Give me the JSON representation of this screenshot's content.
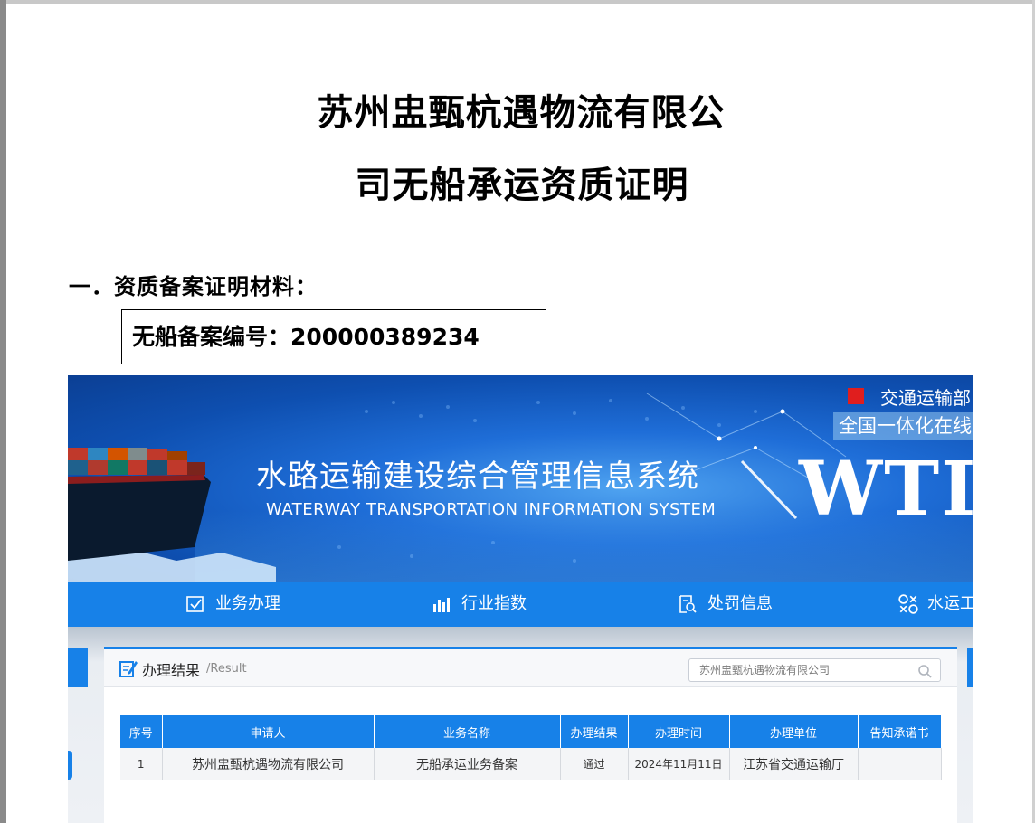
{
  "document": {
    "title_line1": "苏州盅甄杭遇物流有限公",
    "title_line2": "司无船承运资质证明",
    "section_heading": "一．资质备案证明材料：",
    "filing_label": "无船备案编号：",
    "filing_number": "200000389234"
  },
  "portal": {
    "ministry_text": "交通运输部",
    "online_tag": "全国一体化在线",
    "system_title": "水路运输建设综合管理信息系统",
    "system_subtitle": "WATERWAY TRANSPORTATION INFORMATION SYSTEM",
    "system_abbr": "WTIS",
    "nav": [
      {
        "label": "业务办理",
        "icon": "checkbox-form-icon"
      },
      {
        "label": "行业指数",
        "icon": "bar-chart-icon"
      },
      {
        "label": "处罚信息",
        "icon": "document-search-icon"
      },
      {
        "label": "水运工",
        "icon": "tools-icon"
      }
    ],
    "colors": {
      "primary": "#1781e8",
      "mark": "#e01e1e"
    }
  },
  "result": {
    "title": "办理结果",
    "title_en": "/Result",
    "search_value": "苏州盅甄杭遇物流有限公司",
    "columns": [
      "序号",
      "申请人",
      "业务名称",
      "办理结果",
      "办理时间",
      "办理单位",
      "告知承诺书"
    ],
    "rows": [
      [
        "1",
        "苏州盅甄杭遇物流有限公司",
        "无船承运业务备案",
        "通过",
        "2024年11月11日",
        "江苏省交通运输厅",
        ""
      ]
    ]
  }
}
